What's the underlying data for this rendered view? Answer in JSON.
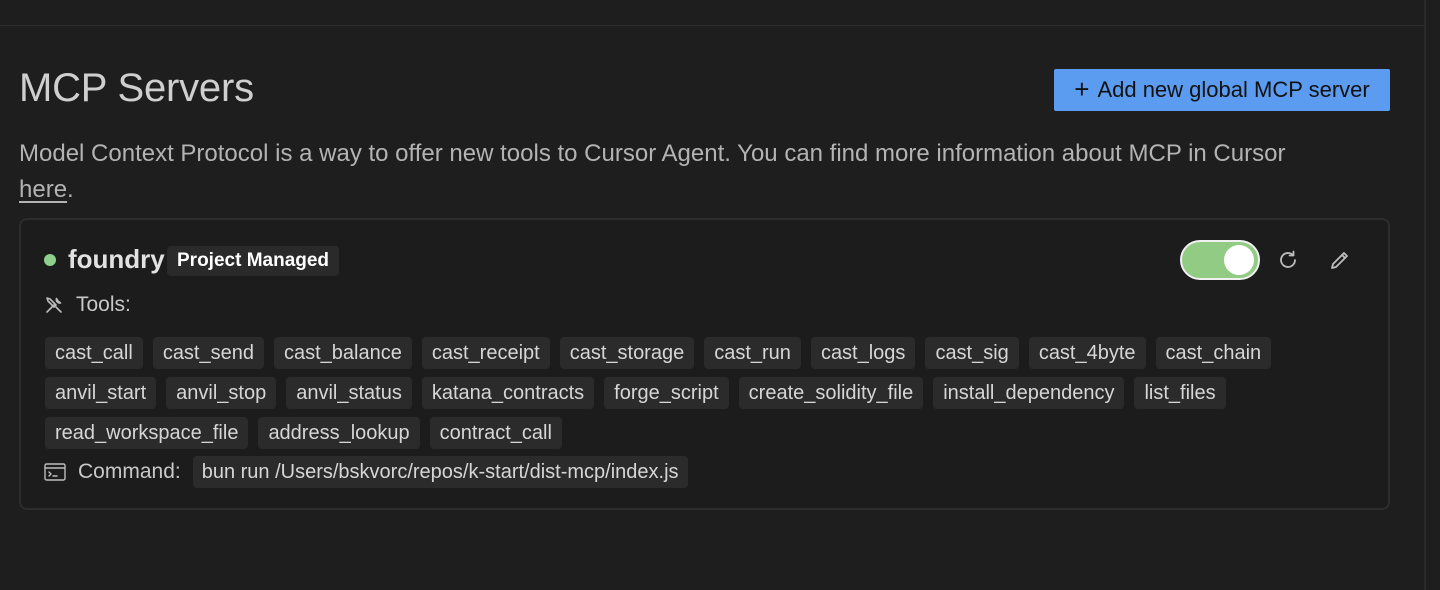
{
  "header": {
    "title": "MCP Servers",
    "add_button_label": "Add new global MCP server",
    "description_text": "Model Context Protocol is a way to offer new tools to Cursor Agent. You can find more information about MCP in Cursor ",
    "description_link": "here",
    "description_end": "."
  },
  "server": {
    "name": "foundry",
    "badge": "Project Managed",
    "status_color": "#8cd08a",
    "enabled": true,
    "tools_label": "Tools:",
    "tools_rows": [
      [
        "cast_call",
        "cast_send",
        "cast_balance",
        "cast_receipt",
        "cast_storage",
        "cast_run",
        "cast_logs",
        "cast_sig",
        "cast_4byte",
        "cast_chain"
      ],
      [
        "anvil_start",
        "anvil_stop",
        "anvil_status",
        "katana_contracts",
        "forge_script",
        "create_solidity_file",
        "install_dependency",
        "list_files"
      ],
      [
        "read_workspace_file",
        "address_lookup",
        "contract_call"
      ]
    ],
    "command_label": "Command:",
    "command": "bun run /Users/bskvorc/repos/k-start/dist-mcp/index.js"
  },
  "colors": {
    "accent": "#5b9cf0",
    "toggle_on": "#92cc84",
    "background": "#1e1e1e"
  },
  "icons": {
    "add": "plus-icon",
    "refresh": "refresh-icon",
    "edit": "pencil-icon",
    "tools": "wrench-screwdriver-icon",
    "command": "terminal-icon"
  }
}
